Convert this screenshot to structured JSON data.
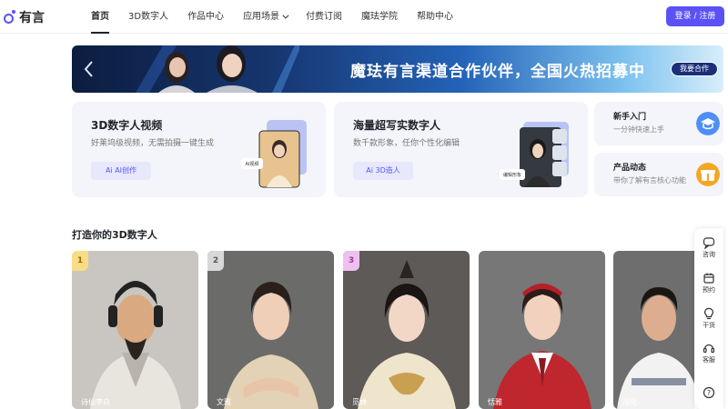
{
  "header": {
    "logo_text": "有言",
    "nav": [
      {
        "label": "首页"
      },
      {
        "label": "3D数字人"
      },
      {
        "label": "作品中心"
      },
      {
        "label": "应用场景"
      },
      {
        "label": "付费订阅"
      },
      {
        "label": "魔珐学院"
      },
      {
        "label": "帮助中心"
      }
    ],
    "login_label": "登录 / 注册"
  },
  "banner": {
    "text": "魔珐有言渠道合作伙伴，全国火热招募中",
    "button_label": "我要合作"
  },
  "feature_cards": [
    {
      "title": "3D数字人视频",
      "desc": "好莱坞级视频，无需拍摄一键生成",
      "button": "Ai AI创作",
      "art_label": "AI视频"
    },
    {
      "title": "海量超写实数字人",
      "desc": "数千款形象，任你个性化编辑",
      "button": "Ai 3D造人",
      "art_label": "编辑形象"
    }
  ],
  "side_cards": [
    {
      "title": "新手入门",
      "desc": "一分钟快速上手",
      "icon": "graduation-cap-icon"
    },
    {
      "title": "产品动态",
      "desc": "带你了解有言核心功能",
      "icon": "gift-box-icon"
    }
  ],
  "section": {
    "title": "打造你的3D数字人",
    "avatars": [
      {
        "rank": "1",
        "name": "诗仙李白",
        "bg": "#c9c6c1",
        "rank_bg": "#f8dc86",
        "rank_color": "#9a6a00"
      },
      {
        "rank": "2",
        "name": "文雅",
        "bg": "#6b6b6a",
        "rank_bg": "#d8d8d8",
        "rank_color": "#555555"
      },
      {
        "rank": "3",
        "name": "觅婵",
        "bg": "#5e5a58",
        "rank_bg": "#eec0ef",
        "rank_color": "#9a3aa0"
      },
      {
        "rank": "",
        "name": "恬雅",
        "bg": "#777777",
        "rank_bg": "",
        "rank_color": ""
      },
      {
        "rank": "",
        "name": "海化",
        "bg": "#6e6e6e",
        "rank_bg": "",
        "rank_color": ""
      }
    ]
  },
  "floating_bar": [
    {
      "label": "咨询",
      "icon": "chat-icon"
    },
    {
      "label": "预约",
      "icon": "calendar-icon"
    },
    {
      "label": "干货",
      "icon": "bulb-icon"
    },
    {
      "label": "客服",
      "icon": "headset-icon"
    },
    {
      "label": "",
      "icon": "help-icon"
    }
  ],
  "colors": {
    "accent": "#5b52f5"
  }
}
